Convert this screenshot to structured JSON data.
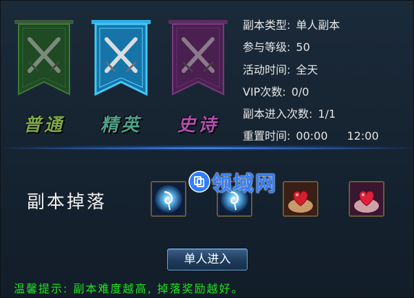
{
  "difficulties": [
    {
      "label": "普通",
      "label_color": "#7fa84a",
      "banner_color": "#1f4a23",
      "banner_accent": "#3c7a3a",
      "selected": false
    },
    {
      "label": "精英",
      "label_color": "#4fa08a",
      "banner_color": "#1674a8",
      "banner_accent": "#42c8f5",
      "selected": true
    },
    {
      "label": "史诗",
      "label_color": "#b24fb0",
      "banner_color": "#4a2050",
      "banner_accent": "#7a3a80",
      "selected": false
    }
  ],
  "info": {
    "type_label": "副本类型:",
    "type_value": "单人副本",
    "level_label": "参与等级:",
    "level_value": "50",
    "time_label": "活动时间:",
    "time_value": "全天",
    "vip_label": "VIP次数:",
    "vip_value": "0/0",
    "entries_label": "副本进入次数:",
    "entries_value": "1/1",
    "reset_label": "重置时间:",
    "reset_value_1": "00:00",
    "reset_value_2": "12:00"
  },
  "drops": {
    "title": "副本掉落",
    "items": [
      {
        "icon": "blue-orb-icon"
      },
      {
        "icon": "blue-orb-icon"
      },
      {
        "icon": "heart-hands-icon"
      },
      {
        "icon": "heart-hands-icon"
      }
    ]
  },
  "watermark": {
    "text": "领域网"
  },
  "enter_button": {
    "label": "单人进入"
  },
  "tip": {
    "text": "温馨提示: 副本难度越高, 掉落奖励越好。"
  }
}
